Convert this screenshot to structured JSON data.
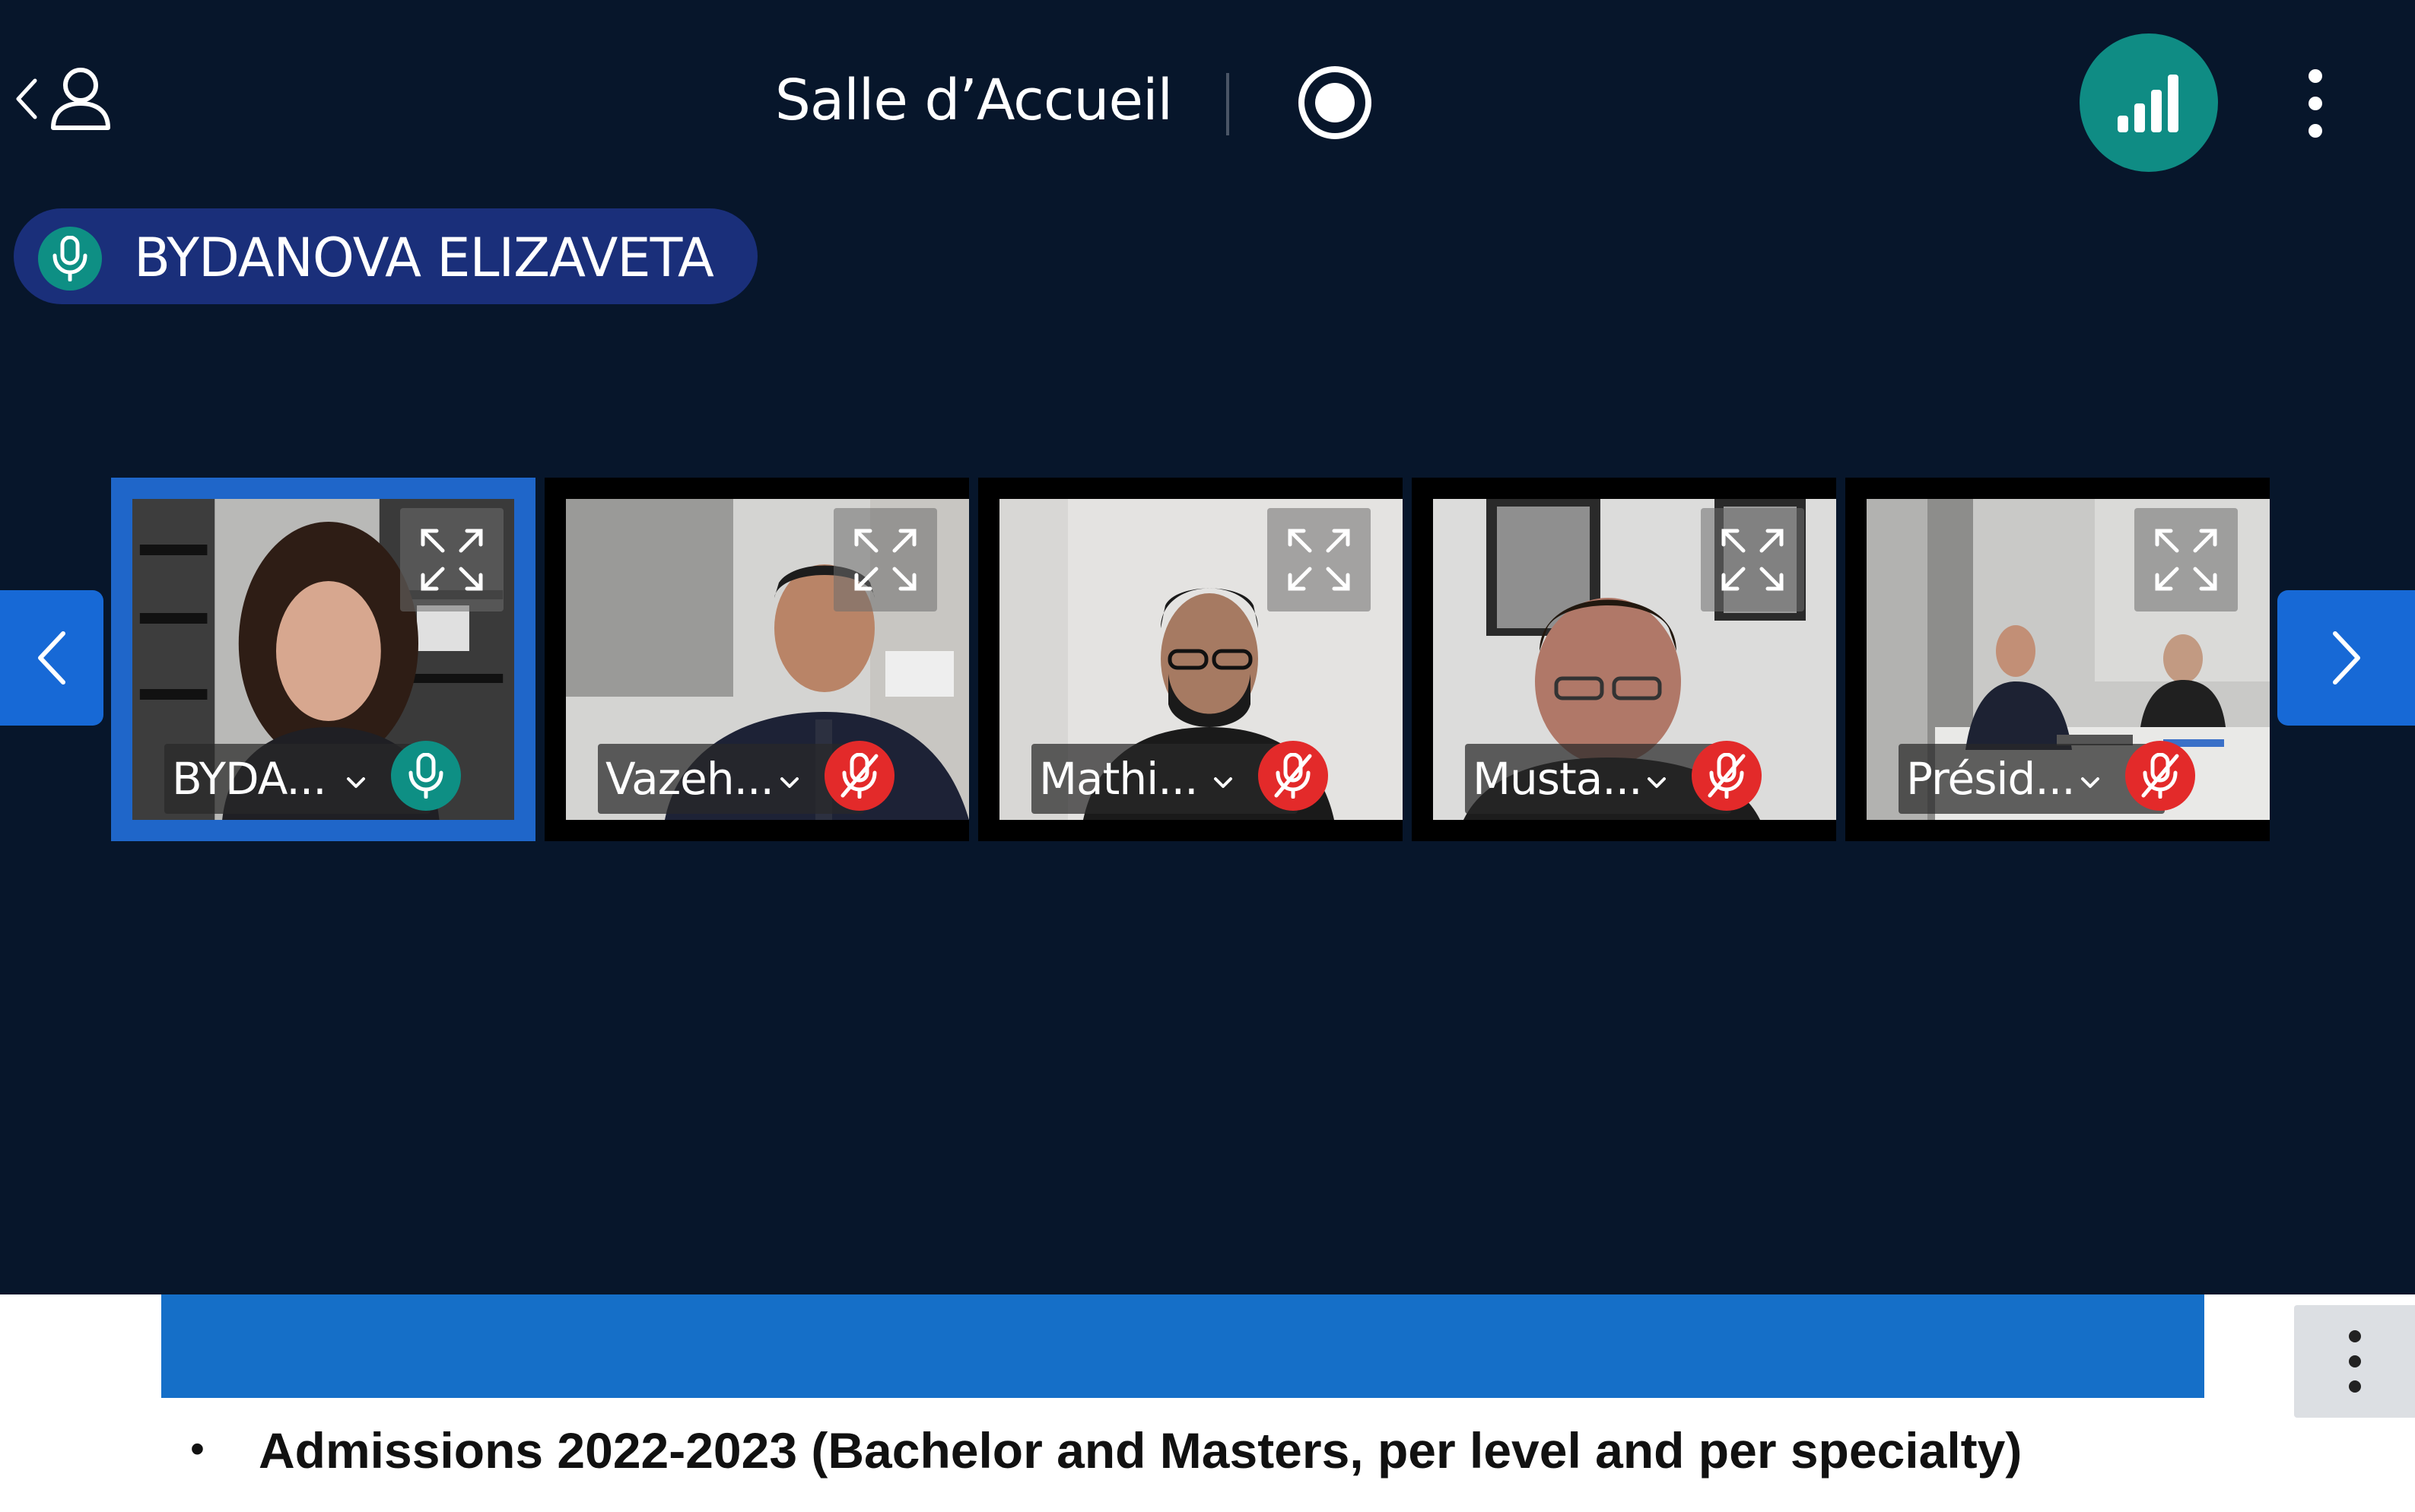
{
  "header": {
    "room_title": "Salle d’Accueil",
    "icons": {
      "back": "chevron-left-icon",
      "participants": "person-icon",
      "record": "record-icon",
      "network": "signal-bars-icon",
      "more": "vertical-dots-icon"
    },
    "network_button_color": "#0f8c84"
  },
  "active_speaker": {
    "name": "BYDANOVA ELIZAVETA",
    "mic_state": "on",
    "pill_color": "#1a2f7a"
  },
  "carousel": {
    "tiles": [
      {
        "label": "BYDA...",
        "mic": "on",
        "active": true
      },
      {
        "label": "Vazeh...",
        "mic": "off",
        "active": false
      },
      {
        "label": "Mathi...",
        "mic": "off",
        "active": false
      },
      {
        "label": "Musta...",
        "mic": "off",
        "active": false
      },
      {
        "label": "Présid...",
        "mic": "off",
        "active": false
      }
    ],
    "nav_color": "#1769d6"
  },
  "slide": {
    "banner_color": "#156fc8",
    "bullet": "•",
    "text": "Admissions 2022-2023 (Bachelor and Masters, per level and per specialty)"
  },
  "colors": {
    "background": "#07162b",
    "mic_on": "#0e8f84",
    "mic_off": "#e32a2a"
  }
}
